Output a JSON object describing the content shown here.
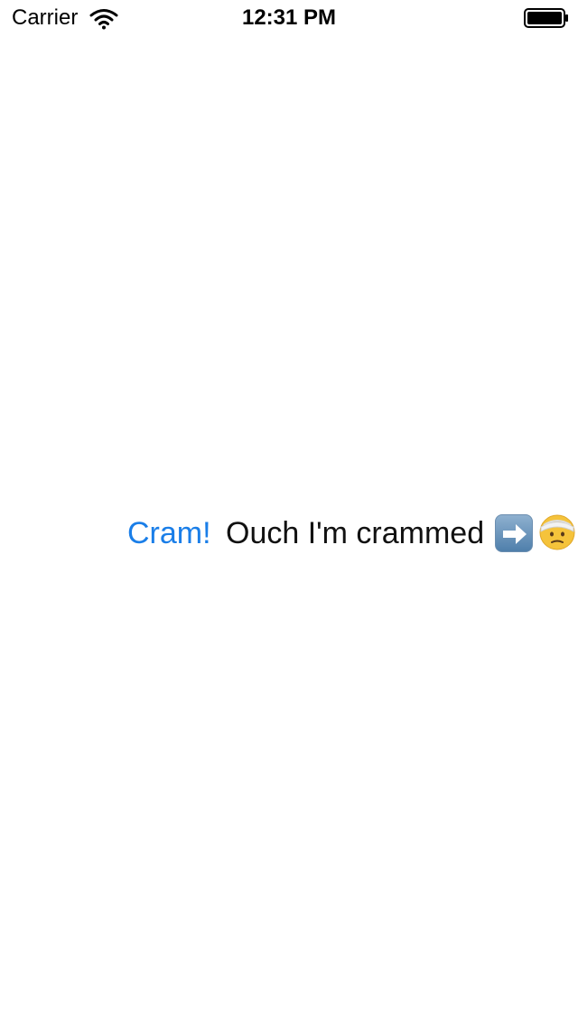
{
  "status_bar": {
    "carrier": "Carrier",
    "time": "12:31 PM",
    "wifi_icon": "wifi-icon",
    "battery_icon": "battery-icon"
  },
  "main": {
    "cram_button_label": "Cram!",
    "crammed_label": "Ouch I'm crammed",
    "arrow_icon": "right-arrow-emoji-icon",
    "face_icon": "face-with-head-bandage-emoji-icon"
  },
  "colors": {
    "accent": "#1a7ee8",
    "text": "#111111",
    "background": "#ffffff"
  }
}
